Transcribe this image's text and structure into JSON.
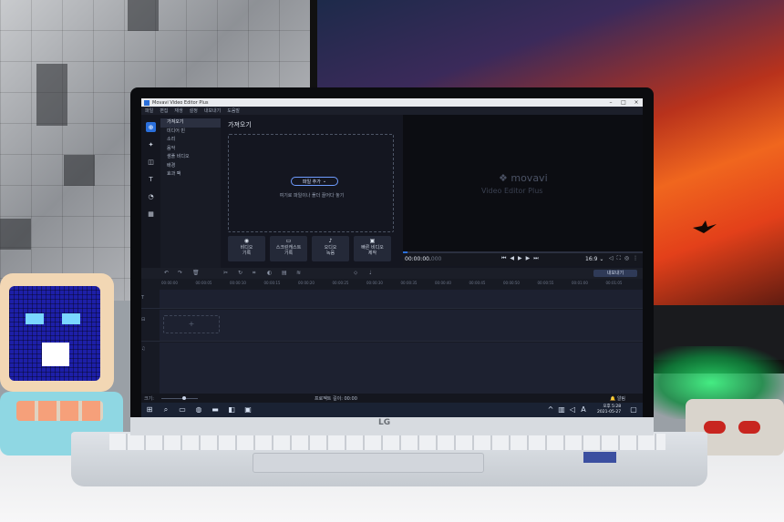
{
  "app": {
    "title": "Movavi Video Editor Plus",
    "menu": [
      "파일",
      "편집",
      "재생",
      "설정",
      "내보내기",
      "도움말"
    ]
  },
  "rail_icons": [
    "import-icon",
    "magic-wand-icon",
    "transitions-icon",
    "titles-icon",
    "stickers-icon",
    "more-tools-icon"
  ],
  "side_menu": {
    "items": [
      "가져오기",
      "미디어 빈",
      "소리",
      "음악",
      "샘플 비디오",
      "배경",
      "효과 팩"
    ]
  },
  "import": {
    "title": "가져오기",
    "add_file_label": "파일 추가",
    "drop_hint": "여기로 파일이나 폴더 끌어다 놓기",
    "quick_buttons": [
      {
        "line1": "비디오",
        "line2": "기록"
      },
      {
        "line1": "스크린캐스트",
        "line2": "기록"
      },
      {
        "line1": "오디오",
        "line2": "녹음"
      },
      {
        "line1": "빠른 비디오",
        "line2": "제작"
      }
    ]
  },
  "preview": {
    "logo": "movavi",
    "subtitle": "Video Editor Plus",
    "timecode_main": "00:00:00",
    "timecode_frames": "000",
    "aspect_ratio": "16:9",
    "progress": 0.02
  },
  "toolbar": {
    "export_label": "내보내기"
  },
  "ruler": {
    "ticks": [
      "00:00:00",
      "00:00:05",
      "00:00:10",
      "00:00:15",
      "00:00:20",
      "00:00:25",
      "00:00:30",
      "00:00:35",
      "00:00:40",
      "00:00:45",
      "00:00:50",
      "00:00:55",
      "00:01:00",
      "00:01:05"
    ]
  },
  "status": {
    "scale_label": "크기:",
    "project_length": "프로젝트 길이: 00:00",
    "notifications": "알림"
  },
  "taskbar": {
    "time": "오후 5:28",
    "date": "2021-05-27"
  },
  "brand": {
    "laptop_logo": "LG"
  },
  "colors": {
    "accent": "#2a6fdb",
    "app_bg": "#141620"
  }
}
